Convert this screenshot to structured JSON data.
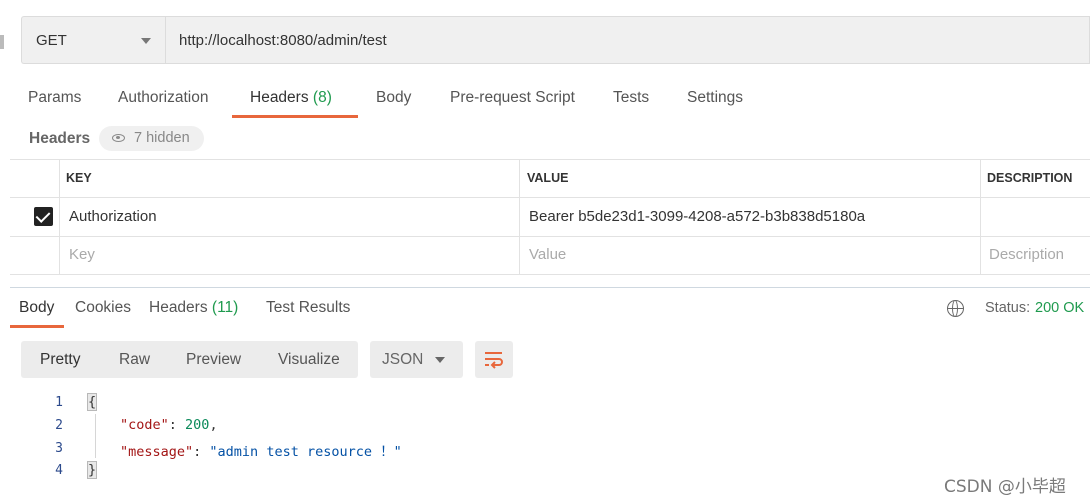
{
  "request": {
    "method": "GET",
    "url": "http://localhost:8080/admin/test"
  },
  "request_tabs": [
    {
      "label": "Params",
      "count": ""
    },
    {
      "label": "Authorization",
      "count": ""
    },
    {
      "label": "Headers",
      "count": "(8)"
    },
    {
      "label": "Body",
      "count": ""
    },
    {
      "label": "Pre-request Script",
      "count": ""
    },
    {
      "label": "Tests",
      "count": ""
    },
    {
      "label": "Settings",
      "count": ""
    }
  ],
  "active_request_tab": "Headers",
  "headers_section": {
    "title": "Headers",
    "hidden_label": "7 hidden",
    "columns": {
      "key": "KEY",
      "value": "VALUE",
      "description": "DESCRIPTION"
    },
    "rows": [
      {
        "checked": true,
        "key": "Authorization",
        "value": "Bearer b5de23d1-3099-4208-a572-b3b838d5180a",
        "description": ""
      }
    ],
    "placeholders": {
      "key": "Key",
      "value": "Value",
      "description": "Description"
    }
  },
  "response_tabs": [
    {
      "label": "Body",
      "count": ""
    },
    {
      "label": "Cookies",
      "count": ""
    },
    {
      "label": "Headers",
      "count": "(11)"
    },
    {
      "label": "Test Results",
      "count": ""
    }
  ],
  "active_response_tab": "Body",
  "status": {
    "label": "Status:",
    "value": "200 OK"
  },
  "view_modes": [
    "Pretty",
    "Raw",
    "Preview",
    "Visualize"
  ],
  "format": "JSON",
  "code_lines": [
    {
      "n": "1",
      "text": "{"
    },
    {
      "n": "2",
      "key": "\"code\"",
      "value": "200"
    },
    {
      "n": "3",
      "key": "\"message\"",
      "value": "\"admin test resource ！\""
    },
    {
      "n": "4",
      "text": "}"
    }
  ],
  "watermark": "CSDN @小毕超",
  "colors": {
    "accent": "#e8673c",
    "success": "#1f9a4e"
  }
}
